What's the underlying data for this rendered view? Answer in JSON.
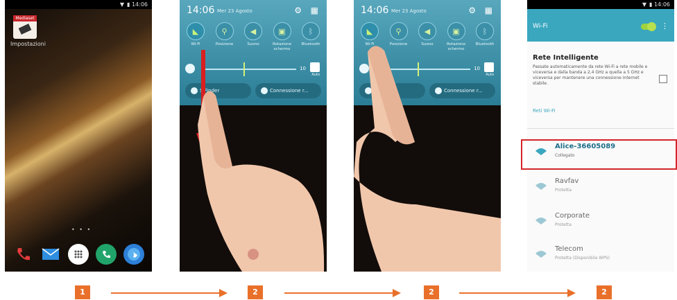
{
  "panel1": {
    "app_tag": "Mediaset",
    "app_label": "Impostazioni",
    "dots": "• • •"
  },
  "quick_settings": {
    "time": "14:06",
    "date": "Mer 23 Agosto",
    "toggles": [
      {
        "icon": "wifi-icon",
        "label": "Wi-Fi"
      },
      {
        "icon": "location-icon",
        "label": "Posizione"
      },
      {
        "icon": "sound-icon",
        "label": "Suono"
      },
      {
        "icon": "screen-rotation-icon",
        "label": "Rotazione schermo"
      },
      {
        "icon": "bluetooth-icon",
        "label": "Bluetooth"
      }
    ],
    "brightness_value": "10",
    "auto_label": "Auto",
    "shortcut_finder": "S Finder",
    "shortcut_connection": "Connessione r..."
  },
  "wifi_screen": {
    "title": "Wi-Fi",
    "smart_title": "Rete Intelligente",
    "smart_desc": "Passate automaticamente da rete Wi-Fi a rete mobile e viceversa e dalla banda a 2,4 GHz a quella a 5 GHz e viceversa per mantenere una connessione Internet stabile.",
    "section": "Reti Wi-Fi",
    "networks": [
      {
        "name": "Alice-36605089",
        "status": "Collegato"
      },
      {
        "name": "Ravfav",
        "status": "Protetta"
      },
      {
        "name": "Corporate",
        "status": "Protetta"
      },
      {
        "name": "Telecom",
        "status": "Protetta (Disponibile WPS)"
      }
    ]
  },
  "steps": [
    "1",
    "2",
    "2",
    "2"
  ],
  "colors": {
    "accent": "#e9702a",
    "highlight": "#d32428",
    "wifi_teal": "#3aa7bf"
  }
}
